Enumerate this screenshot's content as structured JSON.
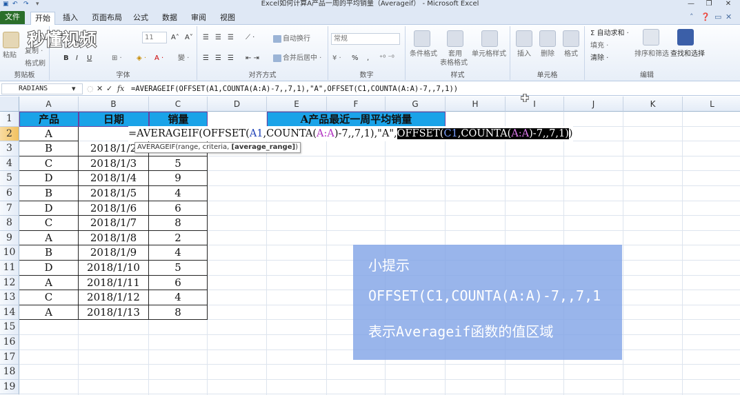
{
  "window": {
    "title": "Excel如何计算A产品一周的平均销量（Averageif） - Microsoft Excel",
    "min_label": "—",
    "restore_label": "❐",
    "close_label": "✕"
  },
  "tabs": [
    {
      "label": "文件"
    },
    {
      "label": "开始"
    },
    {
      "label": "插入"
    },
    {
      "label": "页面布局"
    },
    {
      "label": "公式"
    },
    {
      "label": "数据"
    },
    {
      "label": "审阅"
    },
    {
      "label": "视图"
    }
  ],
  "watermark": "秒懂视频",
  "ribbon": {
    "clipboard": {
      "paste": "粘贴",
      "copy": "复制 ·",
      "format_painter": "格式刷",
      "label": "剪贴板"
    },
    "font": {
      "size": "11",
      "bold": "B",
      "italic": "I",
      "underline": "U",
      "grow": "A˄",
      "shrink": "A˅",
      "label": "字体"
    },
    "alignment": {
      "wrap": "自动换行",
      "merge": "合并后居中 ·",
      "label": "对齐方式"
    },
    "number": {
      "format": "常规",
      "percent": "%",
      "comma": ",",
      "label": "数字"
    },
    "styles": {
      "conditional": "条件格式",
      "table": "套用",
      "table2": "表格格式",
      "cell_styles": "单元格样式",
      "label": "样式"
    },
    "cells": {
      "insert": "插入",
      "delete": "删除",
      "format": "格式",
      "label": "单元格"
    },
    "editing": {
      "autosum": "Σ 自动求和 ·",
      "fill": "填充 ·",
      "clear": "清除 ·",
      "sort": "排序和筛选",
      "find": "查找和选择",
      "label": "编辑"
    }
  },
  "formula_bar": {
    "name_box": "RADIANS",
    "cancel": "✕",
    "enter": "✓",
    "fx": "fx",
    "formula": "=AVERAGEIF(OFFSET(A1,COUNTA(A:A)-7,,7,1),\"A\",OFFSET(C1,COUNTA(A:A)-7,,7,1))"
  },
  "columns": [
    "A",
    "B",
    "C",
    "D",
    "E",
    "F",
    "G",
    "H",
    "I",
    "J",
    "K",
    "L"
  ],
  "rows": [
    "1",
    "2",
    "3",
    "4",
    "5",
    "6",
    "7",
    "8",
    "9",
    "10",
    "11",
    "12",
    "13",
    "14",
    "15",
    "16",
    "17",
    "18",
    "19"
  ],
  "table": {
    "headers": [
      "产品",
      "日期",
      "销量"
    ],
    "merged_header": "A产品最近一周平均销量",
    "data": [
      {
        "product": "A",
        "date": "",
        "sales": ""
      },
      {
        "product": "B",
        "date": "2018/1/2",
        "sales": ""
      },
      {
        "product": "C",
        "date": "2018/1/3",
        "sales": "5"
      },
      {
        "product": "D",
        "date": "2018/1/4",
        "sales": "9"
      },
      {
        "product": "B",
        "date": "2018/1/5",
        "sales": "4"
      },
      {
        "product": "D",
        "date": "2018/1/6",
        "sales": "6"
      },
      {
        "product": "C",
        "date": "2018/1/7",
        "sales": "8"
      },
      {
        "product": "A",
        "date": "2018/1/8",
        "sales": "2"
      },
      {
        "product": "B",
        "date": "2018/1/9",
        "sales": "4"
      },
      {
        "product": "D",
        "date": "2018/1/10",
        "sales": "5"
      },
      {
        "product": "A",
        "date": "2018/1/11",
        "sales": "6"
      },
      {
        "product": "C",
        "date": "2018/1/12",
        "sales": "4"
      },
      {
        "product": "A",
        "date": "2018/1/13",
        "sales": "8"
      }
    ]
  },
  "cell_edit": {
    "p1": "=AVERAGEIF(OFFSET(",
    "a1": "A1",
    "p2": ",COUNTA(",
    "aa1": "A:A",
    "p3": ")-7,,7,1),\"A\",",
    "h1": "OFFSET(",
    "c1": "C1",
    "h2": ",COUNTA(",
    "aa2": "A:A",
    "h3": ")-7,,7,1)",
    "p4": ")"
  },
  "tooltip": {
    "text": "AVERAGEIF(range, criteria, ",
    "bold": "[average_range]",
    "end": ")"
  },
  "tip_box": {
    "title": "小提示",
    "line1": "OFFSET(C1,COUNTA(A:A)-7,,7,1",
    "line2": "表示Averageif函数的值区域"
  },
  "colors": {
    "header_fill": "#1aa3e8",
    "merged_fill": "#1aa3e8",
    "tip_fill": "#82a5e6",
    "selected_header": "#f1c15f"
  }
}
